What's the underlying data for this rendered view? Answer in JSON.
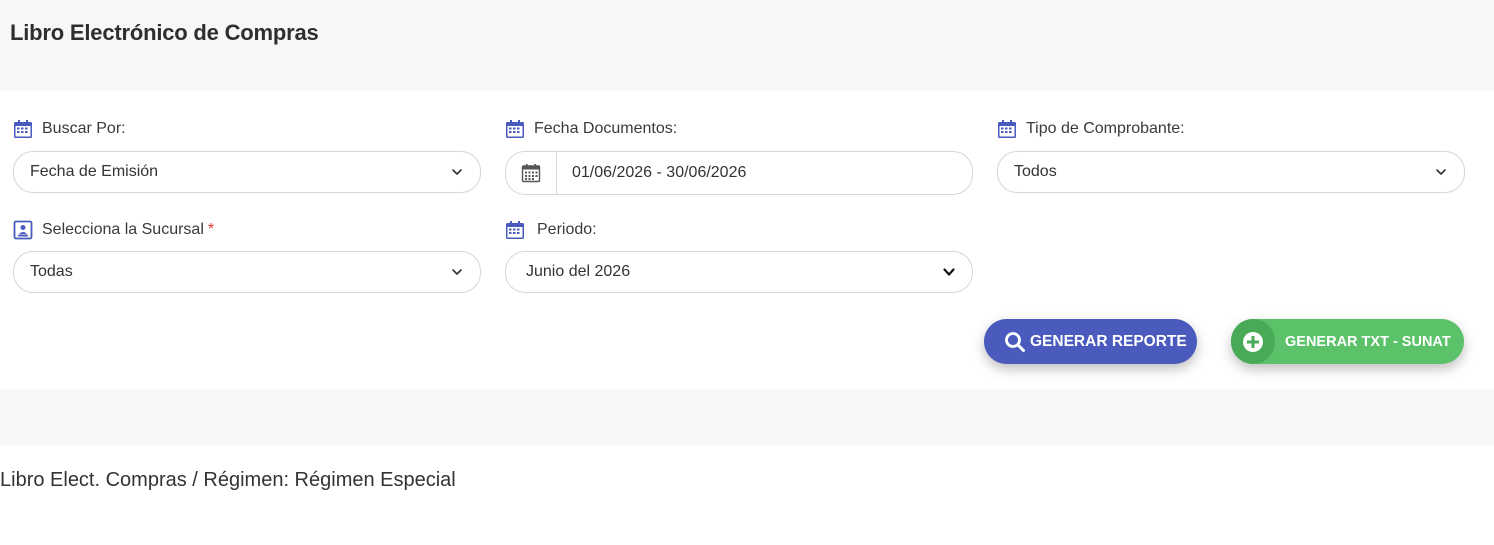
{
  "page": {
    "title": "Libro Electrónico de Compras"
  },
  "filters": {
    "buscar_por": {
      "label": "Buscar Por:",
      "value": "Fecha de Emisión"
    },
    "fecha_documentos": {
      "label": "Fecha Documentos:",
      "value": "01/06/2026 - 30/06/2026"
    },
    "tipo_comprobante": {
      "label": "Tipo de Comprobante:",
      "value": "Todos"
    },
    "sucursal": {
      "label": "Selecciona la Sucursal",
      "required_mark": "*",
      "value": "Todas"
    },
    "periodo": {
      "label": "Periodo:",
      "value": "Junio del 2026"
    }
  },
  "actions": {
    "generar_reporte": "GENERAR REPORTE",
    "generar_txt": "GENERAR TXT - SUNAT"
  },
  "report": {
    "caption": "Libro Elect. Compras / Régimen: Régimen Especial"
  },
  "colors": {
    "primary": "#4a5bbd",
    "success": "#5cc26a",
    "icon": "#4a5bbd",
    "required": "#e53935"
  }
}
